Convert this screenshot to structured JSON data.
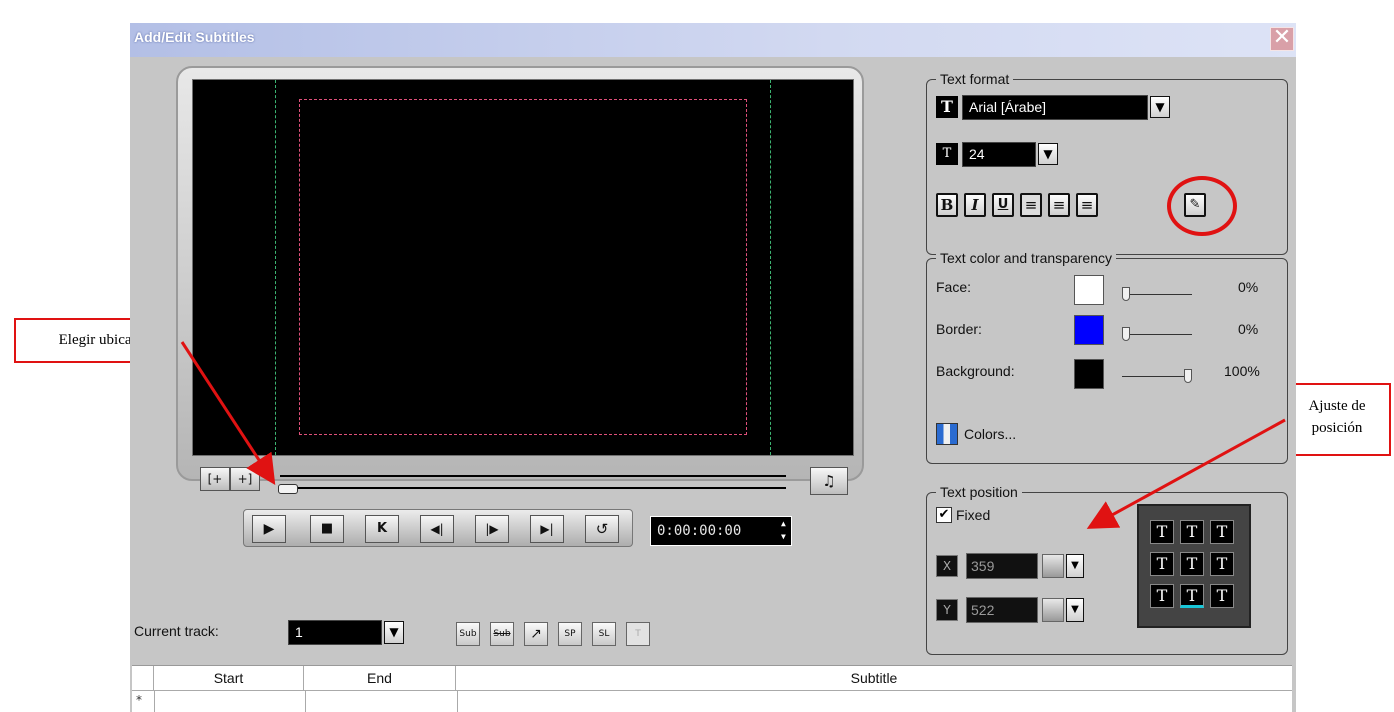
{
  "window": {
    "title": "Add/Edit Subtitles",
    "close_glyph": "✕"
  },
  "player": {
    "mark_in": "[+",
    "mark_out": "+]",
    "music_icon": "♫",
    "controls": {
      "play": "▶",
      "stop": "■",
      "first": "K",
      "prev": "◀|",
      "next": "|▶",
      "last": "▶|",
      "repeat": "↺"
    },
    "timecode": "0:00:00:00",
    "spin": "▲▼"
  },
  "text_format": {
    "legend": "Text format",
    "font_icon": "T",
    "font": "Arial [Árabe]",
    "size_icon": "T",
    "size": "24",
    "dropdown_glyph": "▼",
    "buttons": {
      "bold": "B",
      "italic": "I",
      "underline": "U",
      "left": "≡",
      "center": "≡",
      "right": "≡",
      "edit": "✎"
    }
  },
  "text_color": {
    "legend": "Text color and transparency",
    "face_label": "Face:",
    "face_value": "0%",
    "face_color": "#ffffff",
    "border_label": "Border:",
    "border_value": "0%",
    "border_color": "#0000ff",
    "background_label": "Background:",
    "background_value": "100%",
    "background_color": "#000000",
    "face_level": 0,
    "border_level": 0,
    "background_level": 1,
    "colors_button": "Colors..."
  },
  "text_position": {
    "legend": "Text position",
    "fixed_label": "Fixed",
    "fixed_checked": true,
    "check_glyph": "✔",
    "x_value": "359",
    "y_value": "522",
    "grid_glyph": "T"
  },
  "track": {
    "label": "Current track:",
    "value": "1"
  },
  "toolbar_icons": [
    "Sub",
    "Sub",
    "↗",
    "SP",
    "SL",
    "T"
  ],
  "table": {
    "columns": [
      "Start",
      "End",
      "Subtitle"
    ],
    "new_row_marker": "*"
  },
  "annotations": {
    "left_callout": "Elegir ubicación",
    "right_callout": [
      "Ajuste de",
      "posición"
    ],
    "highlight_color": "#e01212"
  }
}
